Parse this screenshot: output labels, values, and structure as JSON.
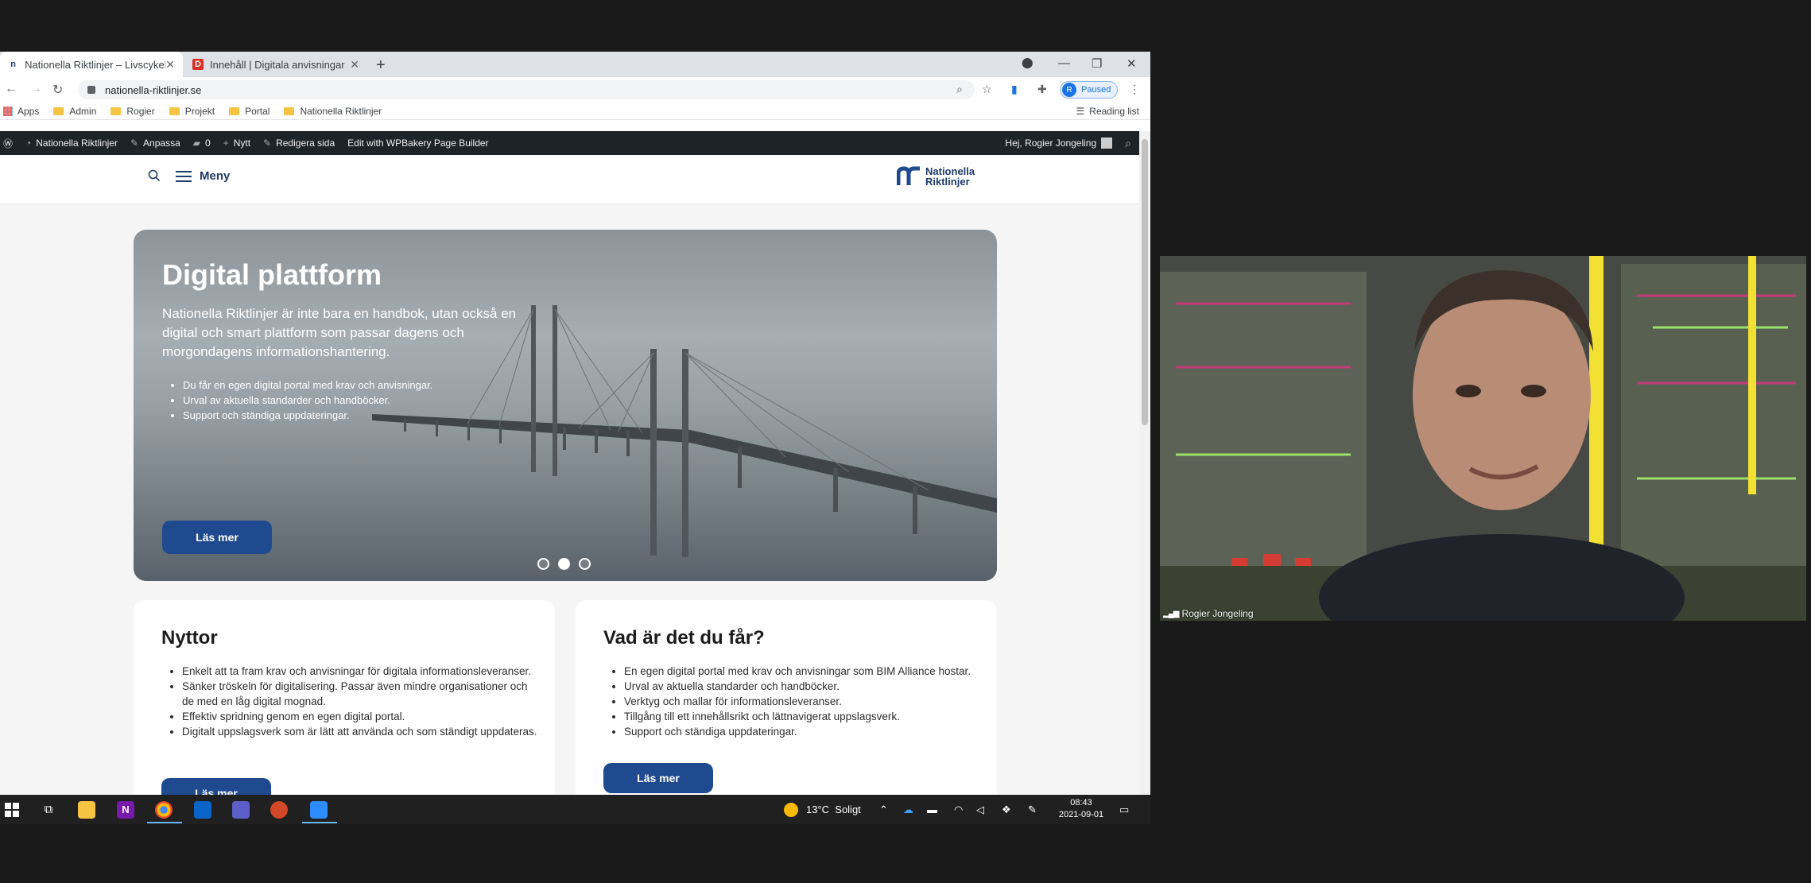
{
  "browser": {
    "tabs": [
      {
        "title": "Nationella Riktlinjer – Livscykelin"
      },
      {
        "title": "Innehåll | Digitala anvisningar"
      }
    ],
    "url": "nationella-riktlinjer.se",
    "profile": {
      "initial": "R",
      "status": "Paused"
    },
    "bookmarks": [
      "Apps",
      "Admin",
      "Rogier",
      "Projekt",
      "Portal",
      "Nationella Riktlinjer"
    ],
    "reading_list": "Reading list"
  },
  "wp_admin_bar": {
    "site": "Nationella Riktlinjer",
    "customize": "Anpassa",
    "comments": "0",
    "new": "Nytt",
    "edit": "Redigera sida",
    "builder": "Edit with WPBakery Page Builder",
    "greeting": "Hej, Rogier Jongeling"
  },
  "site": {
    "menu_label": "Meny",
    "logo_line1": "Nationella",
    "logo_line2": "Riktlinjer",
    "brand_color": "#1f4a8f"
  },
  "hero": {
    "title": "Digital plattform",
    "lead": "Nationella Riktlinjer är inte bara en handbok, utan också en digital och smart plattform som passar dagens och morgondagens informationshantering.",
    "bullets": [
      "Du får en egen digital portal med krav och anvisningar.",
      "Urval av aktuella standarder och handböcker.",
      "Support och ständiga uppdateringar."
    ],
    "button": "Läs mer",
    "slides": 3,
    "active_slide": 2
  },
  "cards": [
    {
      "title": "Nyttor",
      "bullets": [
        "Enkelt att ta fram krav och anvisningar för digitala informationsleveranser.",
        "Sänker tröskeln för digitalisering. Passar även mindre organisationer och de med en låg digital mognad.",
        "Effektiv spridning genom en egen digital portal.",
        "Digitalt uppslagsverk som är lätt att använda och som ständigt uppdateras."
      ],
      "button": "Läs mer"
    },
    {
      "title": "Vad är det du får?",
      "bullets": [
        "En egen digital portal med krav och anvisningar som BIM Alliance hostar.",
        "Urval av aktuella standarder och handböcker.",
        "Verktyg och mallar för informationsleveranser.",
        "Tillgång till ett innehållsrikt och lättnavigerat uppslagsverk.",
        "Support och ständiga uppdateringar."
      ],
      "button": "Läs mer"
    }
  ],
  "taskbar": {
    "weather": "13°C  Soligt",
    "time": "08:43",
    "date": "2021-09-01"
  },
  "video": {
    "participant": "Rogier Jongeling"
  }
}
